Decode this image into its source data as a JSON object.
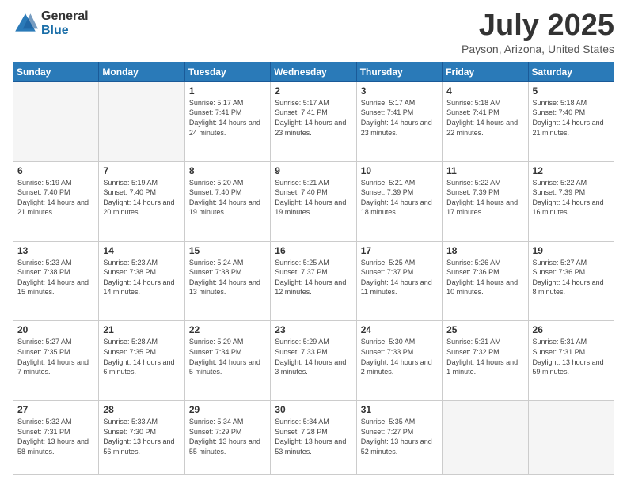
{
  "logo": {
    "general": "General",
    "blue": "Blue"
  },
  "header": {
    "month": "July 2025",
    "location": "Payson, Arizona, United States"
  },
  "days_of_week": [
    "Sunday",
    "Monday",
    "Tuesday",
    "Wednesday",
    "Thursday",
    "Friday",
    "Saturday"
  ],
  "weeks": [
    [
      {
        "day": "",
        "info": ""
      },
      {
        "day": "",
        "info": ""
      },
      {
        "day": "1",
        "info": "Sunrise: 5:17 AM\nSunset: 7:41 PM\nDaylight: 14 hours\nand 24 minutes."
      },
      {
        "day": "2",
        "info": "Sunrise: 5:17 AM\nSunset: 7:41 PM\nDaylight: 14 hours\nand 23 minutes."
      },
      {
        "day": "3",
        "info": "Sunrise: 5:17 AM\nSunset: 7:41 PM\nDaylight: 14 hours\nand 23 minutes."
      },
      {
        "day": "4",
        "info": "Sunrise: 5:18 AM\nSunset: 7:41 PM\nDaylight: 14 hours\nand 22 minutes."
      },
      {
        "day": "5",
        "info": "Sunrise: 5:18 AM\nSunset: 7:40 PM\nDaylight: 14 hours\nand 21 minutes."
      }
    ],
    [
      {
        "day": "6",
        "info": "Sunrise: 5:19 AM\nSunset: 7:40 PM\nDaylight: 14 hours\nand 21 minutes."
      },
      {
        "day": "7",
        "info": "Sunrise: 5:19 AM\nSunset: 7:40 PM\nDaylight: 14 hours\nand 20 minutes."
      },
      {
        "day": "8",
        "info": "Sunrise: 5:20 AM\nSunset: 7:40 PM\nDaylight: 14 hours\nand 19 minutes."
      },
      {
        "day": "9",
        "info": "Sunrise: 5:21 AM\nSunset: 7:40 PM\nDaylight: 14 hours\nand 19 minutes."
      },
      {
        "day": "10",
        "info": "Sunrise: 5:21 AM\nSunset: 7:39 PM\nDaylight: 14 hours\nand 18 minutes."
      },
      {
        "day": "11",
        "info": "Sunrise: 5:22 AM\nSunset: 7:39 PM\nDaylight: 14 hours\nand 17 minutes."
      },
      {
        "day": "12",
        "info": "Sunrise: 5:22 AM\nSunset: 7:39 PM\nDaylight: 14 hours\nand 16 minutes."
      }
    ],
    [
      {
        "day": "13",
        "info": "Sunrise: 5:23 AM\nSunset: 7:38 PM\nDaylight: 14 hours\nand 15 minutes."
      },
      {
        "day": "14",
        "info": "Sunrise: 5:23 AM\nSunset: 7:38 PM\nDaylight: 14 hours\nand 14 minutes."
      },
      {
        "day": "15",
        "info": "Sunrise: 5:24 AM\nSunset: 7:38 PM\nDaylight: 14 hours\nand 13 minutes."
      },
      {
        "day": "16",
        "info": "Sunrise: 5:25 AM\nSunset: 7:37 PM\nDaylight: 14 hours\nand 12 minutes."
      },
      {
        "day": "17",
        "info": "Sunrise: 5:25 AM\nSunset: 7:37 PM\nDaylight: 14 hours\nand 11 minutes."
      },
      {
        "day": "18",
        "info": "Sunrise: 5:26 AM\nSunset: 7:36 PM\nDaylight: 14 hours\nand 10 minutes."
      },
      {
        "day": "19",
        "info": "Sunrise: 5:27 AM\nSunset: 7:36 PM\nDaylight: 14 hours\nand 8 minutes."
      }
    ],
    [
      {
        "day": "20",
        "info": "Sunrise: 5:27 AM\nSunset: 7:35 PM\nDaylight: 14 hours\nand 7 minutes."
      },
      {
        "day": "21",
        "info": "Sunrise: 5:28 AM\nSunset: 7:35 PM\nDaylight: 14 hours\nand 6 minutes."
      },
      {
        "day": "22",
        "info": "Sunrise: 5:29 AM\nSunset: 7:34 PM\nDaylight: 14 hours\nand 5 minutes."
      },
      {
        "day": "23",
        "info": "Sunrise: 5:29 AM\nSunset: 7:33 PM\nDaylight: 14 hours\nand 3 minutes."
      },
      {
        "day": "24",
        "info": "Sunrise: 5:30 AM\nSunset: 7:33 PM\nDaylight: 14 hours\nand 2 minutes."
      },
      {
        "day": "25",
        "info": "Sunrise: 5:31 AM\nSunset: 7:32 PM\nDaylight: 14 hours\nand 1 minute."
      },
      {
        "day": "26",
        "info": "Sunrise: 5:31 AM\nSunset: 7:31 PM\nDaylight: 13 hours\nand 59 minutes."
      }
    ],
    [
      {
        "day": "27",
        "info": "Sunrise: 5:32 AM\nSunset: 7:31 PM\nDaylight: 13 hours\nand 58 minutes."
      },
      {
        "day": "28",
        "info": "Sunrise: 5:33 AM\nSunset: 7:30 PM\nDaylight: 13 hours\nand 56 minutes."
      },
      {
        "day": "29",
        "info": "Sunrise: 5:34 AM\nSunset: 7:29 PM\nDaylight: 13 hours\nand 55 minutes."
      },
      {
        "day": "30",
        "info": "Sunrise: 5:34 AM\nSunset: 7:28 PM\nDaylight: 13 hours\nand 53 minutes."
      },
      {
        "day": "31",
        "info": "Sunrise: 5:35 AM\nSunset: 7:27 PM\nDaylight: 13 hours\nand 52 minutes."
      },
      {
        "day": "",
        "info": ""
      },
      {
        "day": "",
        "info": ""
      }
    ]
  ]
}
